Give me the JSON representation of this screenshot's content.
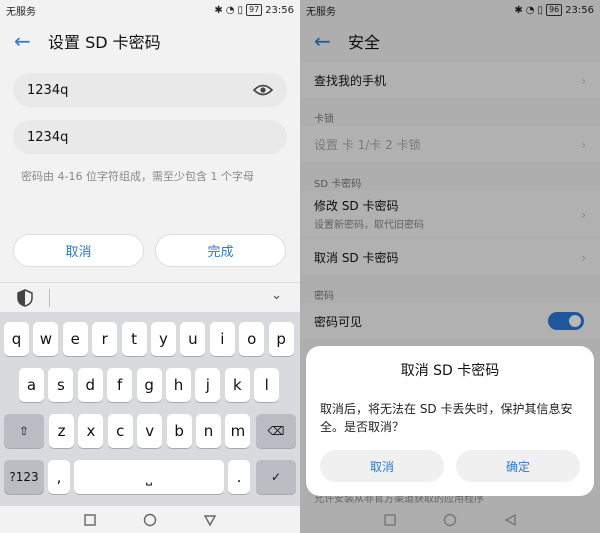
{
  "left": {
    "status": {
      "carrier": "无服务",
      "battery": "97",
      "time": "23:56"
    },
    "title": "设置 SD 卡密码",
    "password1": "1234q",
    "password2": "1234q",
    "hint": "密码由 4-16 位字符组成，需至少包含 1 个字母",
    "cancel": "取消",
    "done": "完成",
    "keyboard": {
      "row1": [
        "q",
        "w",
        "e",
        "r",
        "t",
        "y",
        "u",
        "i",
        "o",
        "p"
      ],
      "row2": [
        "a",
        "s",
        "d",
        "f",
        "g",
        "h",
        "j",
        "k",
        "l"
      ],
      "row3": [
        "z",
        "x",
        "c",
        "v",
        "b",
        "n",
        "m"
      ],
      "symbols": "?123"
    }
  },
  "right": {
    "status": {
      "carrier": "无服务",
      "battery": "96",
      "time": "23:56"
    },
    "title": "安全",
    "find_phone": "查找我的手机",
    "section_lock": "卡锁",
    "sim_lock": "设置 卡 1/卡 2 卡锁",
    "section_sd": "SD 卡密码",
    "modify_sd": "修改 SD 卡密码",
    "modify_sd_sub": "设置新密码，取代旧密码",
    "cancel_sd": "取消 SD 卡密码",
    "section_pw": "密码",
    "pw_visible": "密码可见",
    "dialog": {
      "title": "取消 SD 卡密码",
      "message": "取消后，将无法在 SD 卡丢失时，保护其信息安全。是否取消？",
      "cancel": "取消",
      "confirm": "确定"
    },
    "peek": "允许安装从非官方渠道获取的应用程序"
  }
}
